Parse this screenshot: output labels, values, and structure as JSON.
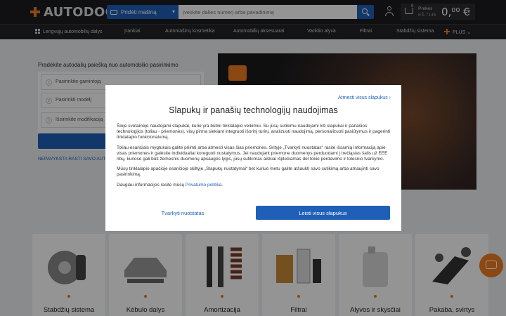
{
  "header": {
    "logo_text": "AUTODOC",
    "add_car_label": "Pridėti mašiną",
    "search_placeholder": "Įveskite dalies numerį arba pavadinimą",
    "cart": {
      "label": "Prekės",
      "phone": "KŠ-7146",
      "total": "0,⁰⁰ €"
    }
  },
  "nav": {
    "items": [
      "Lengvųjų automobilių dalys",
      "Įrankiai",
      "Automašinų kosmetika",
      "Automobilių aksesuarai",
      "Variklio alyva",
      "Filtrai",
      "Stabdžių sistema",
      "PLUS"
    ]
  },
  "picker": {
    "title": "Pradėkite autodalių paiešką nuo automobilio pasirinkimo",
    "fields": [
      "Pasirinkite gamintoją",
      "Pasirinkti modelį",
      "Išsirinkite modifikaciją"
    ],
    "not_found": "NEPAVYKSTA RASTI SAVO AUTO"
  },
  "categories": [
    "Stabdžių sistema",
    "Kėbulo dalys",
    "Amortizacija",
    "Filtrai",
    "Alyvos ir skysčiai",
    "Pakaba, svirtys"
  ],
  "cookie_modal": {
    "reject_all": "Atmesti visus slapukus",
    "title": "Slapukų ir panašių technologijų naudojimas",
    "para1": "Šioje svetainėje naudojami slapukai, kurie yra būtini tinklalapio veikimui. Su jūsų sutikimu naudojami kiti slapukai ir panašios technologijos (toliau - priemonės), visų pirma siekiant integruoti išorinį turinį, analizuoti naudojimą, personalizuoti pasiūlymus ir pagerinti tinklalapio funkcionalumą.",
    "para2": "Toliau esančiais mygtukais galite priimti arba atmesti visas šias priemones. Srityje „Tvarkyti nuostatas“ rasite išsamią informaciją apie visas priemones ir galėsite individualiai koreguoti nustatymus. Jei naudojant priemone duomenys perduodami į trečiąsias šalis už EEE ribų, kuriose gali būti žemesnis duomenų apsaugos lygis, jūsų sutikimas aiškiai išplečiamas dėl tokio perdavimo ir tolesnio tvarkymo.",
    "para3": "Mūsų tinklalapio apačioje esančioje skiltyje „Slapukų nustatymai“ bet kuriuo metu galite atšaukti savo sutikimą arba atnaujinti savo pasirinkimą.",
    "para4_prefix": "Daugiau informacijos rasite mūsų ",
    "privacy_link": "Privatumo politika",
    "para4_suffix": ".",
    "manage_button": "Tvarkyti nuostatas",
    "accept_button": "Leisti visus slapukus"
  },
  "colors": {
    "accent": "#ef7d22",
    "primary": "#1f5fb8",
    "header_bg": "#1c1d20"
  }
}
